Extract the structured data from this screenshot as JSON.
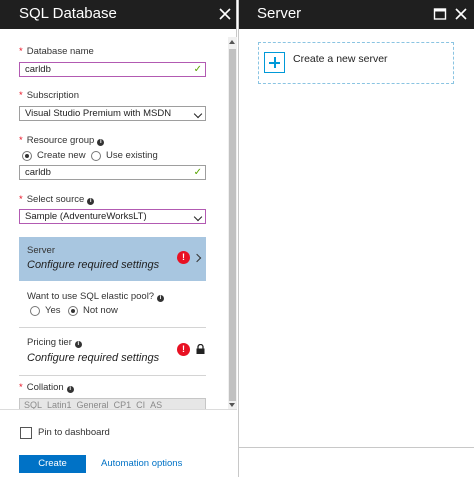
{
  "left_blade": {
    "title": "SQL Database",
    "close_icon": "close-icon"
  },
  "form": {
    "database_name": {
      "label": "Database name",
      "value": "carldb",
      "required": true
    },
    "subscription": {
      "label": "Subscription",
      "value": "Visual Studio Premium with MSDN",
      "required": true
    },
    "resource_group": {
      "label": "Resource group",
      "required": true,
      "options": [
        "Create new",
        "Use existing"
      ],
      "selected": "Create new",
      "value": "carldb"
    },
    "select_source": {
      "label": "Select source",
      "value": "Sample (AdventureWorksLT)",
      "required": true
    },
    "server": {
      "label": "Server",
      "status": "Configure required settings"
    },
    "elastic_pool": {
      "label": "Want to use SQL elastic pool?",
      "options": [
        "Yes",
        "Not now"
      ],
      "selected": "Not now"
    },
    "pricing_tier": {
      "label": "Pricing tier",
      "status": "Configure required settings"
    },
    "collation": {
      "label": "Collation",
      "value": "SQL_Latin1_General_CP1_CI_AS",
      "required": true
    }
  },
  "footer": {
    "pin_label": "Pin to dashboard",
    "pin_checked": false,
    "create_label": "Create",
    "automation_label": "Automation options"
  },
  "right_blade": {
    "title": "Server",
    "new_server_label": "Create a new server"
  },
  "colors": {
    "header_bg": "#1f1f1f",
    "accent": "#0072c6",
    "error": "#e81123",
    "selected_section": "#a8c6e0",
    "valid": "#57a300"
  }
}
